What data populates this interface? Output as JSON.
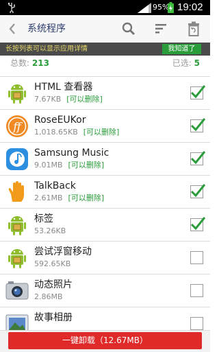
{
  "status_bar": {
    "usb_icon": "usb-icon",
    "battery_percent": "95%",
    "time": "19:02"
  },
  "app_bar": {
    "title": "系统程序",
    "back_icon": "back-arrow-icon",
    "search_icon": "search-icon",
    "sort_icon": "sort-icon",
    "trash_icon": "trash-icon"
  },
  "hint": {
    "message": "长按列表可以显示应用详情",
    "button": "我知道了"
  },
  "summary": {
    "total_label": "总数:",
    "total_value": "213",
    "selected_label": "已选:",
    "selected_value": "5"
  },
  "apps": [
    {
      "name": "HTML 查看器",
      "size": "7.67KB",
      "tag": "[可以删除]",
      "checked": true,
      "icon": "android-icon"
    },
    {
      "name": "RoseEUKor",
      "size": "1,018.65KB",
      "tag": "[可以删除]",
      "checked": true,
      "icon": "font-ff-icon"
    },
    {
      "name": "Samsung Music",
      "size": "9.01MB",
      "tag": "[可以删除]",
      "checked": true,
      "icon": "music-note-icon"
    },
    {
      "name": "TalkBack",
      "size": "2.61MB",
      "tag": "[可以删除]",
      "checked": true,
      "icon": "hand-icon"
    },
    {
      "name": "标签",
      "size": "53.26KB",
      "tag": "",
      "checked": true,
      "icon": "android-icon"
    },
    {
      "name": "尝试浮窗移动",
      "size": "592.65KB",
      "tag": "",
      "checked": false,
      "icon": "android-icon"
    },
    {
      "name": "动态照片",
      "size": "2.86MB",
      "tag": "",
      "checked": false,
      "icon": "camera-icon"
    },
    {
      "name": "故事相册",
      "size": "",
      "tag": "",
      "checked": false,
      "icon": "photo-album-icon"
    }
  ],
  "bottom": {
    "uninstall_label": "一键卸载（12.67MB）"
  },
  "colors": {
    "accent_green": "#2a9d3a",
    "uninstall_red": "#e02a2a",
    "title_blue": "#2b3c6e"
  }
}
